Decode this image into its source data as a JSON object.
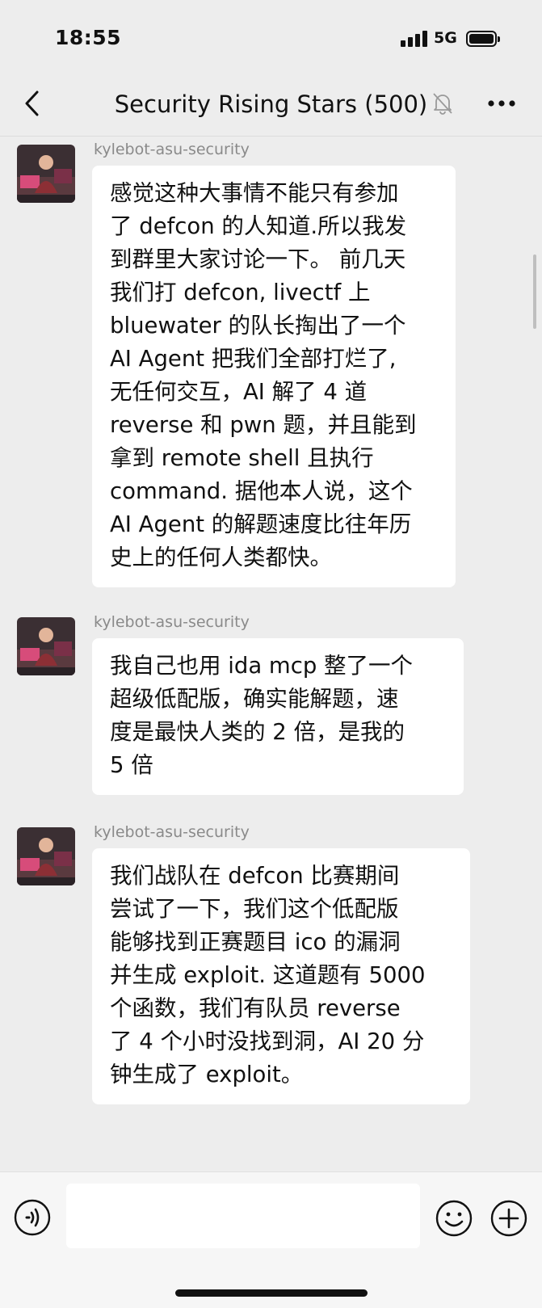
{
  "status_bar": {
    "time": "18:55",
    "network": "5G",
    "icons": [
      "signal-icon",
      "battery-icon"
    ]
  },
  "nav": {
    "title": "Security Rising Stars (500)",
    "icons": [
      "back-icon",
      "mute-icon",
      "more-icon"
    ]
  },
  "messages": [
    {
      "sender": "kylebot-asu-security",
      "lines": [
        "感觉这种大事情不能只有参加",
        "了 defcon 的人知道.所以我发",
        "到群里大家讨论一下。 前几天",
        "我们打 defcon, livectf 上",
        "bluewater 的队长掏出了一个",
        "AI Agent 把我们全部打烂了,",
        "无任何交互，AI 解了 4 道",
        "reverse 和 pwn 题，并且能到",
        "拿到 remote shell 且执行",
        "command. 据他本人说，这个",
        "AI Agent 的解题速度比往年历",
        "史上的任何人类都快。"
      ]
    },
    {
      "sender": "kylebot-asu-security",
      "lines": [
        "我自己也用 ida mcp 整了一个",
        "超级低配版，确实能解题，速",
        "度是最快人类的 2 倍，是我的",
        "5 倍"
      ]
    },
    {
      "sender": "kylebot-asu-security",
      "lines": [
        "我们战队在 defcon 比赛期间",
        "尝试了一下，我们这个低配版",
        "能够找到正赛题目 ico 的漏洞",
        "并生成 exploit. 这道题有 5000",
        "个函数，我们有队员 reverse",
        "了 4 个小时没找到洞，AI 20 分",
        "钟生成了 exploit。"
      ]
    }
  ],
  "input_bar": {
    "placeholder": "",
    "icons": [
      "voice-icon",
      "emoji-icon",
      "add-icon"
    ]
  },
  "colors": {
    "background": "#ededed",
    "bubble": "#ffffff",
    "sender_text": "#8a8a8a"
  }
}
